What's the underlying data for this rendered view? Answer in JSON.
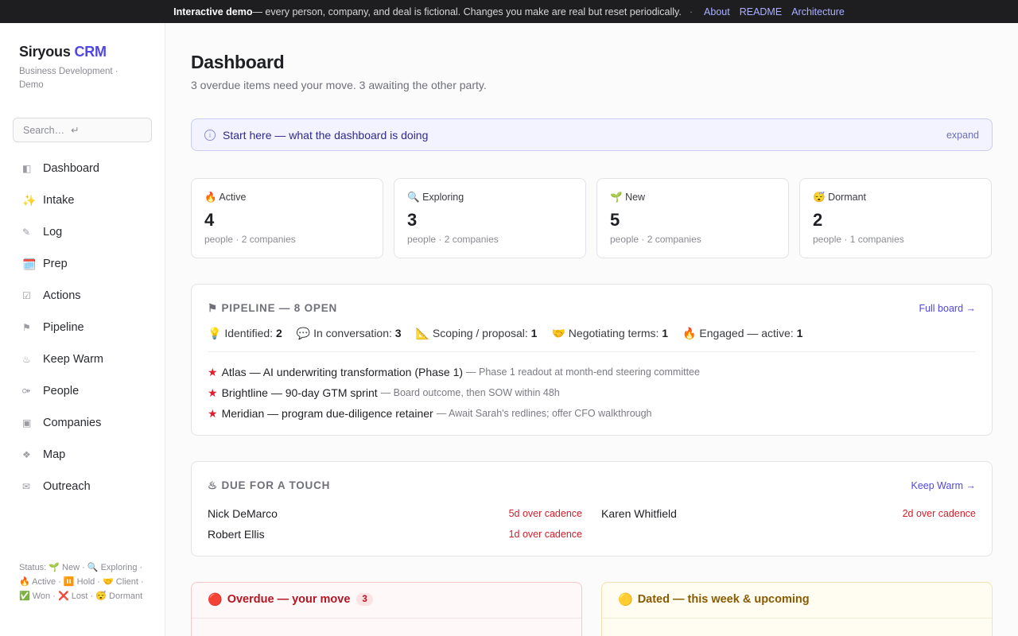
{
  "banner": {
    "strong": "Interactive demo",
    "text": " — every person, company, and deal is fictional. Changes you make are real but reset periodically.",
    "sep": "·",
    "links": [
      "About",
      "README",
      "Architecture"
    ]
  },
  "sidebar": {
    "brand_main": "Siryous",
    "brand_accent": "CRM",
    "brand_sub": "Business Development · Demo",
    "search_placeholder": "Search…",
    "search_hint": "↵",
    "items": [
      {
        "icon": "◧",
        "label": "Dashboard"
      },
      {
        "icon": "✨",
        "label": "Intake"
      },
      {
        "icon": "✎",
        "label": "Log"
      },
      {
        "icon": "🗓️",
        "label": "Prep"
      },
      {
        "icon": "☑",
        "label": "Actions"
      },
      {
        "icon": "⚑",
        "label": "Pipeline"
      },
      {
        "icon": "♨",
        "label": "Keep Warm"
      },
      {
        "icon": "⚩",
        "label": "People"
      },
      {
        "icon": "▣",
        "label": "Companies"
      },
      {
        "icon": "❖",
        "label": "Map"
      },
      {
        "icon": "✉",
        "label": "Outreach"
      }
    ],
    "legend": "Status: 🌱 New · 🔍 Exploring · 🔥 Active · ⏸️ Hold · 🤝 Client · ✅ Won · ❌ Lost · 😴 Dormant"
  },
  "main": {
    "title": "Dashboard",
    "subtitle": "3 overdue items need your move. 3 awaiting the other party.",
    "callout": {
      "icon": "i",
      "text": "Start here — what the dashboard is doing",
      "action": "expand"
    },
    "cards": [
      {
        "emoji": "🔥",
        "label": "Active",
        "count": "4",
        "sub": "people · 2 companies"
      },
      {
        "emoji": "🔍",
        "label": "Exploring",
        "count": "3",
        "sub": "people · 2 companies"
      },
      {
        "emoji": "🌱",
        "label": "New",
        "count": "5",
        "sub": "people · 2 companies"
      },
      {
        "emoji": "😴",
        "label": "Dormant",
        "count": "2",
        "sub": "people · 1 companies"
      }
    ],
    "pipeline": {
      "heading": "⚑ PIPELINE — 8 OPEN",
      "link": "Full board →",
      "stages": [
        {
          "emoji": "💡",
          "label": "Identified:",
          "count": "2"
        },
        {
          "emoji": "💬",
          "label": "In conversation:",
          "count": "3"
        },
        {
          "emoji": "📐",
          "label": "Scoping / proposal:",
          "count": "1"
        },
        {
          "emoji": "🤝",
          "label": "Negotiating terms:",
          "count": "1"
        },
        {
          "emoji": "🔥",
          "label": "Engaged — active:",
          "count": "1"
        }
      ],
      "deals": [
        {
          "star": "★",
          "name": "Atlas — AI underwriting transformation (Phase 1)",
          "note": "— Phase 1 readout at month-end steering committee"
        },
        {
          "star": "★",
          "name": "Brightline — 90-day GTM sprint",
          "note": "— Board outcome, then SOW within 48h"
        },
        {
          "star": "★",
          "name": "Meridian — program due-diligence retainer",
          "note": "— Await Sarah's redlines; offer CFO walkthrough"
        }
      ]
    },
    "touch": {
      "heading": "♨ DUE FOR A TOUCH",
      "link": "Keep Warm →",
      "people": [
        {
          "name": "Nick DeMarco",
          "over": "5d over cadence"
        },
        {
          "name": "Karen Whitfield",
          "over": "2d over cadence"
        },
        {
          "name": "Robert Ellis",
          "over": "1d over cadence"
        }
      ]
    },
    "overdue": {
      "icon": "🔴",
      "title": "Overdue — your move",
      "count": "3"
    },
    "dated": {
      "icon": "🟡",
      "title": "Dated — this week & upcoming"
    }
  },
  "colors": {
    "accent": "#4f46e5",
    "danger": "#d11f2a",
    "warning": "#8a5a00",
    "banner_bg": "#1e1e20"
  }
}
